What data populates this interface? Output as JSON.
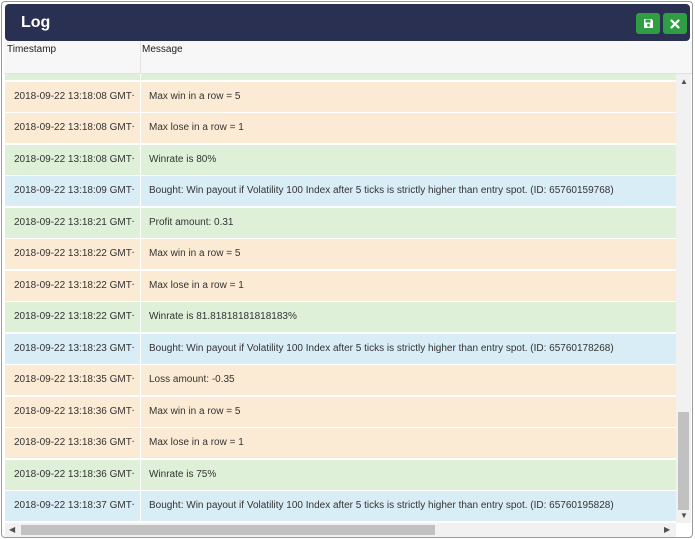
{
  "window": {
    "title": "Log",
    "save_icon": "save-icon",
    "close_icon": "close-icon"
  },
  "table": {
    "columns": [
      "Timestamp",
      "Message"
    ],
    "rows": [
      {
        "timestamp": "",
        "message": "",
        "color": "green"
      },
      {
        "timestamp": "2018-09-22 13:18:08 GMT+",
        "message": "Max win in a row = 5",
        "color": "orange"
      },
      {
        "timestamp": "2018-09-22 13:18:08 GMT+",
        "message": "Max lose in a row = 1",
        "color": "orange"
      },
      {
        "timestamp": "2018-09-22 13:18:08 GMT+",
        "message": "Winrate is 80%",
        "color": "green"
      },
      {
        "timestamp": "2018-09-22 13:18:09 GMT+",
        "message": "Bought: Win payout if Volatility 100 Index after 5 ticks is strictly higher than entry spot. (ID: 65760159768)",
        "color": "blue"
      },
      {
        "timestamp": "2018-09-22 13:18:21 GMT+",
        "message": "Profit amount: 0.31",
        "color": "green"
      },
      {
        "timestamp": "2018-09-22 13:18:22 GMT+",
        "message": "Max win in a row = 5",
        "color": "orange"
      },
      {
        "timestamp": "2018-09-22 13:18:22 GMT+",
        "message": "Max lose in a row = 1",
        "color": "orange"
      },
      {
        "timestamp": "2018-09-22 13:18:22 GMT+",
        "message": "Winrate is 81.81818181818183%",
        "color": "green"
      },
      {
        "timestamp": "2018-09-22 13:18:23 GMT+",
        "message": "Bought: Win payout if Volatility 100 Index after 5 ticks is strictly higher than entry spot. (ID: 65760178268)",
        "color": "blue"
      },
      {
        "timestamp": "2018-09-22 13:18:35 GMT+",
        "message": "Loss amount: -0.35",
        "color": "orange"
      },
      {
        "timestamp": "2018-09-22 13:18:36 GMT+",
        "message": "Max win in a row = 5",
        "color": "orange"
      },
      {
        "timestamp": "2018-09-22 13:18:36 GMT+",
        "message": "Max lose in a row = 1",
        "color": "orange"
      },
      {
        "timestamp": "2018-09-22 13:18:36 GMT+",
        "message": "Winrate is 75%",
        "color": "green"
      },
      {
        "timestamp": "2018-09-22 13:18:37 GMT+",
        "message": "Bought: Win payout if Volatility 100 Index after 5 ticks is strictly higher than entry spot. (ID: 65760195828)",
        "color": "blue"
      }
    ]
  },
  "colors": {
    "titlebar": "#2a3052",
    "button": "#2e9d43",
    "row_green": "#dff0d8",
    "row_orange": "#fcebd4",
    "row_blue": "#d9edf7"
  },
  "scrollbars": {
    "up_icon": "arrow-up-icon",
    "down_icon": "arrow-down-icon",
    "left_icon": "arrow-left-icon",
    "right_icon": "arrow-right-icon"
  }
}
